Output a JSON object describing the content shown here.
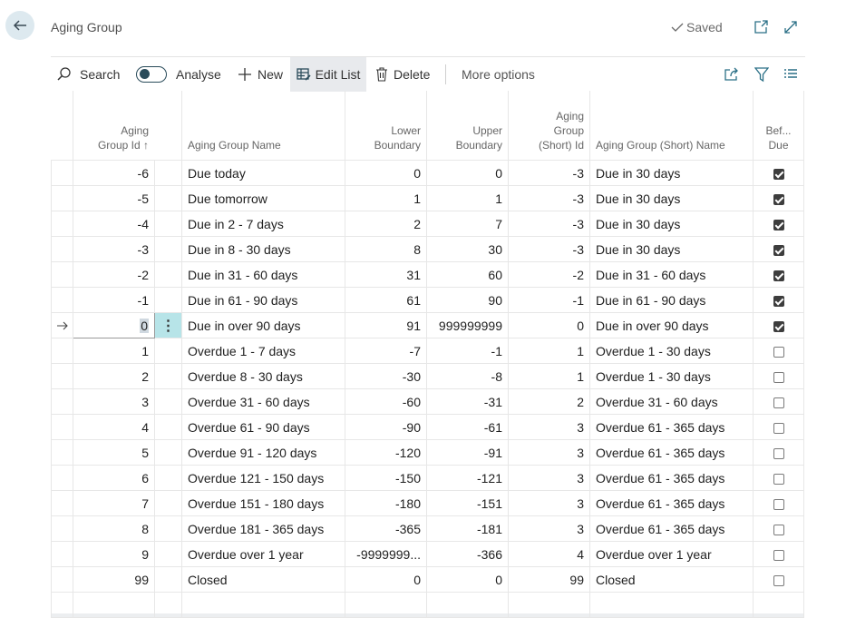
{
  "page": {
    "title": "Aging Group",
    "status": "Saved"
  },
  "toolbar": {
    "search": "Search",
    "analyse": "Analyse",
    "new": "New",
    "edit_list": "Edit List",
    "delete": "Delete",
    "more_options": "More options"
  },
  "columns": {
    "id_line1": "Aging",
    "id_line2": "Group Id ↑",
    "name": "Aging Group Name",
    "lower_line1": "Lower",
    "lower_line2": "Boundary",
    "upper_line1": "Upper",
    "upper_line2": "Boundary",
    "short_id_line1": "Aging",
    "short_id_line2": "Group",
    "short_id_line3": "(Short) Id",
    "short_name": "Aging Group (Short) Name",
    "before_line1": "Bef...",
    "before_line2": "Due"
  },
  "rows": [
    {
      "id": "-6",
      "name": "Due today",
      "lower": "0",
      "upper": "0",
      "short_id": "-3",
      "short_name": "Due in 30 days",
      "before_due": true
    },
    {
      "id": "-5",
      "name": "Due tomorrow",
      "lower": "1",
      "upper": "1",
      "short_id": "-3",
      "short_name": "Due in 30 days",
      "before_due": true
    },
    {
      "id": "-4",
      "name": "Due in 2 - 7 days",
      "lower": "2",
      "upper": "7",
      "short_id": "-3",
      "short_name": "Due in 30 days",
      "before_due": true
    },
    {
      "id": "-3",
      "name": "Due in 8 - 30 days",
      "lower": "8",
      "upper": "30",
      "short_id": "-3",
      "short_name": "Due in 30 days",
      "before_due": true
    },
    {
      "id": "-2",
      "name": "Due in 31 - 60 days",
      "lower": "31",
      "upper": "60",
      "short_id": "-2",
      "short_name": "Due in 31 - 60 days",
      "before_due": true
    },
    {
      "id": "-1",
      "name": "Due in 61 - 90 days",
      "lower": "61",
      "upper": "90",
      "short_id": "-1",
      "short_name": "Due in 61 - 90 days",
      "before_due": true
    },
    {
      "id": "0",
      "name": "Due in over 90 days",
      "lower": "91",
      "upper": "999999999",
      "short_id": "0",
      "short_name": "Due in over 90 days",
      "before_due": true,
      "selected": true
    },
    {
      "id": "1",
      "name": "Overdue 1 - 7 days",
      "lower": "-7",
      "upper": "-1",
      "short_id": "1",
      "short_name": "Overdue 1 - 30 days",
      "before_due": false
    },
    {
      "id": "2",
      "name": "Overdue 8 - 30 days",
      "lower": "-30",
      "upper": "-8",
      "short_id": "1",
      "short_name": "Overdue 1 - 30 days",
      "before_due": false
    },
    {
      "id": "3",
      "name": "Overdue 31 - 60 days",
      "lower": "-60",
      "upper": "-31",
      "short_id": "2",
      "short_name": "Overdue 31 - 60 days",
      "before_due": false
    },
    {
      "id": "4",
      "name": "Overdue 61 - 90 days",
      "lower": "-90",
      "upper": "-61",
      "short_id": "3",
      "short_name": "Overdue 61 - 365 days",
      "before_due": false
    },
    {
      "id": "5",
      "name": "Overdue 91 - 120 days",
      "lower": "-120",
      "upper": "-91",
      "short_id": "3",
      "short_name": "Overdue 61 - 365 days",
      "before_due": false
    },
    {
      "id": "6",
      "name": "Overdue 121 - 150 days",
      "lower": "-150",
      "upper": "-121",
      "short_id": "3",
      "short_name": "Overdue 61 - 365 days",
      "before_due": false
    },
    {
      "id": "7",
      "name": "Overdue 151 - 180 days",
      "lower": "-180",
      "upper": "-151",
      "short_id": "3",
      "short_name": "Overdue 61 - 365 days",
      "before_due": false
    },
    {
      "id": "8",
      "name": "Overdue 181 - 365 days",
      "lower": "-365",
      "upper": "-181",
      "short_id": "3",
      "short_name": "Overdue 61 - 365 days",
      "before_due": false
    },
    {
      "id": "9",
      "name": "Overdue over 1 year",
      "lower": "-9999999...",
      "upper": "-366",
      "short_id": "4",
      "short_name": "Overdue over 1 year",
      "before_due": false
    },
    {
      "id": "99",
      "name": "Closed",
      "lower": "0",
      "upper": "0",
      "short_id": "99",
      "short_name": "Closed",
      "before_due": false
    }
  ],
  "colors": {
    "accent": "#2a4b5a",
    "selected_row_action": "#b7e4e8",
    "back_button_bg": "#dde9ef"
  },
  "icons": {
    "back": "arrow-left-icon",
    "saved": "check-icon",
    "open_new": "open-in-new-window-icon",
    "expand": "expand-icon",
    "search": "search-icon",
    "new": "plus-icon",
    "edit_list": "edit-list-icon",
    "delete": "trash-icon",
    "share": "share-icon",
    "filter": "filter-icon",
    "list_view": "list-view-icon",
    "row_marker": "arrow-right-icon",
    "row_actions": "more-vertical-icon"
  }
}
